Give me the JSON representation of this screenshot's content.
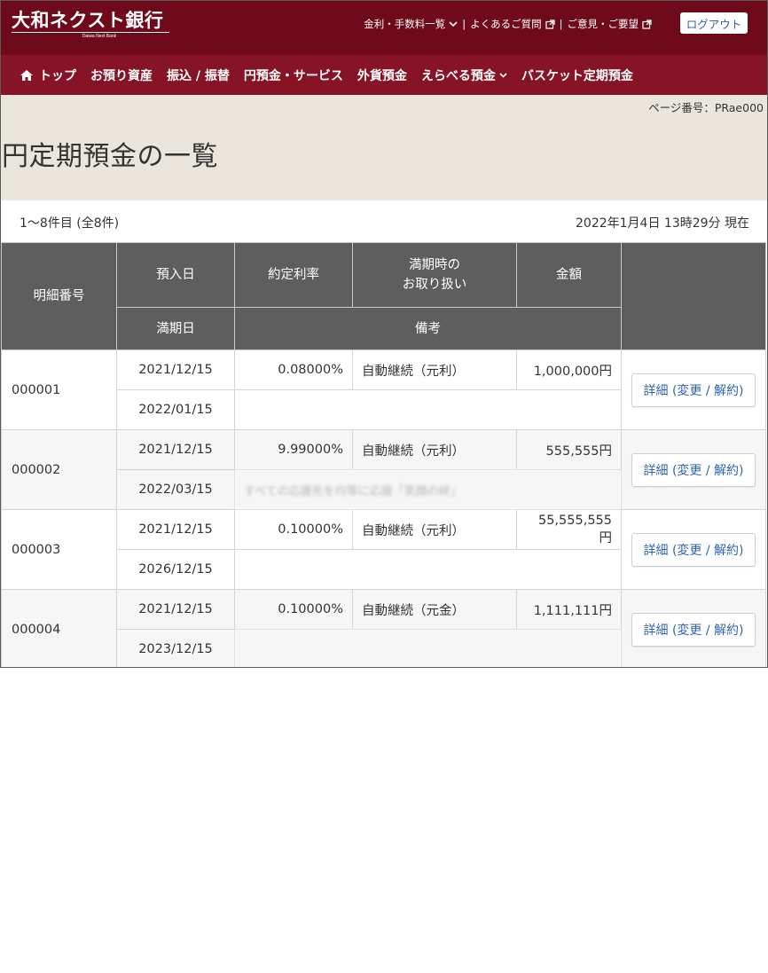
{
  "header": {
    "logo_text": "大和ネクスト銀行",
    "logo_sub": "Daiwa Next Bank",
    "util_links": [
      {
        "label": "金利・手数料一覧",
        "icon": "chevron-down-icon"
      },
      {
        "label": "よくあるご質問",
        "icon": "external-link-icon"
      },
      {
        "label": "ご意見・ご要望",
        "icon": "external-link-icon"
      }
    ],
    "util_separator": "|",
    "logout_label": "ログアウト"
  },
  "nav": {
    "items": [
      {
        "label": "トップ",
        "icon": "home-icon"
      },
      {
        "label": "お預り資産"
      },
      {
        "label": "振込 / 振替"
      },
      {
        "label": "円預金・サービス"
      },
      {
        "label": "外貨預金"
      },
      {
        "label": "えらべる預金",
        "icon": "chevron-down-icon"
      },
      {
        "label": "バスケット定期預金"
      }
    ]
  },
  "page": {
    "page_number": "ページ番号：PRae000",
    "title": "円定期預金の一覧",
    "count_text": "1〜8件目 (全8件)",
    "as_of": "2022年1月4日 13時29分 現在"
  },
  "table": {
    "headers": {
      "detail_no": "明細番号",
      "deposit_date": "預入日",
      "rate": "約定利率",
      "maturity_handling_1": "満期時の",
      "maturity_handling_2": "お取り扱い",
      "amount": "金額",
      "maturity_date": "満期日",
      "remarks": "備考"
    },
    "rows": [
      {
        "no": "000001",
        "deposit_date": "2021/12/15",
        "rate": "0.08000%",
        "handling": "自動継続（元利）",
        "amount": "1,000,000円",
        "maturity": "2022/01/15",
        "remarks": "",
        "action": "詳細 (変更 / 解約)"
      },
      {
        "no": "000002",
        "deposit_date": "2021/12/15",
        "rate": "9.99000%",
        "handling": "自動継続（元利）",
        "amount": "555,555円",
        "maturity": "2022/03/15",
        "remarks": "すべての応援先を均等に応援「笑顔の絆」",
        "action": "詳細 (変更 / 解約)"
      },
      {
        "no": "000003",
        "deposit_date": "2021/12/15",
        "rate": "0.10000%",
        "handling": "自動継続（元利）",
        "amount": "55,555,555円",
        "maturity": "2026/12/15",
        "remarks": "",
        "action": "詳細 (変更 / 解約)"
      },
      {
        "no": "000004",
        "deposit_date": "2021/12/15",
        "rate": "0.10000%",
        "handling": "自動継続（元金）",
        "amount": "1,111,111円",
        "maturity": "2023/12/15",
        "remarks": "",
        "action": "詳細 (変更 / 解約)"
      }
    ]
  },
  "colors": {
    "header_bg": "#6e0a1a",
    "nav_bg": "#871426",
    "title_bg": "#ebe6dd",
    "table_header_bg": "#5e5e5e",
    "link": "#2d63b4"
  }
}
